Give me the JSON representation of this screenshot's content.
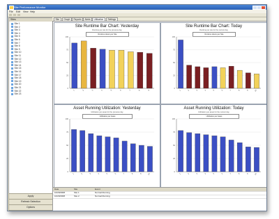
{
  "window": {
    "title": "Site Performance Monitor",
    "menu": [
      "File",
      "Edit",
      "View",
      "Help"
    ]
  },
  "sidebar": {
    "header": "Sites",
    "items": [
      "Site 1",
      "Site 2",
      "Site 3",
      "Site 4",
      "Site 5",
      "Site 6",
      "Site 7",
      "Site 8",
      "Site 9",
      "Site 10",
      "Site 11",
      "Site 12",
      "Site 13",
      "Site 14",
      "Site 15",
      "Site 16",
      "Site 17",
      "Site 18",
      "Site 19",
      "Site 20",
      "Site 21",
      "Site 22",
      "Site 23"
    ],
    "buttons": [
      "Apply",
      "Refresh Selection",
      "Options"
    ]
  },
  "tabs": [
    "Site",
    "Graph",
    "Reports",
    "Alerts",
    "Utilization",
    "Settings"
  ],
  "colors": {
    "blue": "#3b4fc4",
    "maroon": "#7a1f22",
    "yellow": "#f2d25a",
    "gold": "#e8b640"
  },
  "panels": [
    {
      "title": "Site Runtime Bar Chart: Yesterday",
      "subtitle": "Runtime per site for the previous day",
      "legend": "Runtime Hours per Site"
    },
    {
      "title": "Site Runtime Bar Chart: Today",
      "subtitle": "Runtime per site for the current day",
      "legend": "Runtime Hours per Site"
    },
    {
      "title": "Asset Running Utilization: Yesterday",
      "subtitle": "Utilization per asset for the previous day",
      "legend": "Utilization per Asset"
    },
    {
      "title": "Asset Running Utilization: Today",
      "subtitle": "Utilization per asset for the current day",
      "legend": "Utilization per Asset"
    }
  ],
  "chart_data": [
    {
      "type": "bar",
      "categories": [
        "1",
        "2",
        "3",
        "4",
        "5",
        "6",
        "7",
        "8",
        "9"
      ],
      "values": [
        88,
        92,
        78,
        76,
        74,
        74,
        71,
        70,
        68
      ],
      "ylim": [
        0,
        100
      ],
      "colors": [
        "#3b4fc4",
        "#e8b640",
        "#7a1f22",
        "#3b4fc4",
        "#f2d25a",
        "#f2d25a",
        "#f2d25a",
        "#7a1f22",
        "#7a1f22"
      ]
    },
    {
      "type": "bar",
      "categories": [
        "1",
        "2",
        "3",
        "4",
        "5",
        "6",
        "7",
        "8",
        "9",
        "10"
      ],
      "values": [
        94,
        45,
        42,
        40,
        42,
        40,
        43,
        35,
        30,
        28
      ],
      "ylim": [
        0,
        100
      ],
      "colors": [
        "#3b4fc4",
        "#7a1f22",
        "#7a1f22",
        "#7a1f22",
        "#3b4fc4",
        "#f2d25a",
        "#7a1f22",
        "#f2d25a",
        "#7a1f22",
        "#f2d25a"
      ]
    },
    {
      "type": "bar",
      "categories": [
        "1",
        "2",
        "3",
        "4",
        "5",
        "6",
        "7",
        "8",
        "9",
        "10"
      ],
      "values": [
        80,
        78,
        72,
        68,
        66,
        64,
        58,
        53,
        50,
        48
      ],
      "ylim": [
        0,
        100
      ],
      "colors": [
        "#3b4fc4",
        "#3b4fc4",
        "#3b4fc4",
        "#3b4fc4",
        "#3b4fc4",
        "#3b4fc4",
        "#3b4fc4",
        "#3b4fc4",
        "#3b4fc4",
        "#3b4fc4"
      ]
    },
    {
      "type": "bar",
      "categories": [
        "1",
        "2",
        "3",
        "4",
        "5",
        "6",
        "7",
        "8",
        "9",
        "10"
      ],
      "values": [
        78,
        74,
        72,
        70,
        68,
        66,
        60,
        55,
        47,
        46
      ],
      "ylim": [
        0,
        100
      ],
      "colors": [
        "#3b4fc4",
        "#3b4fc4",
        "#3b4fc4",
        "#3b4fc4",
        "#3b4fc4",
        "#3b4fc4",
        "#3b4fc4",
        "#3b4fc4",
        "#3b4fc4",
        "#3b4fc4"
      ]
    }
  ],
  "status": {
    "headers": [
      "Date",
      "Site",
      "Event"
    ],
    "rows": [
      [
        "10/29/2008",
        "Site 1",
        "Normal Running"
      ],
      [
        "10/29/2008",
        "Site 2",
        "Normal Running"
      ]
    ]
  }
}
